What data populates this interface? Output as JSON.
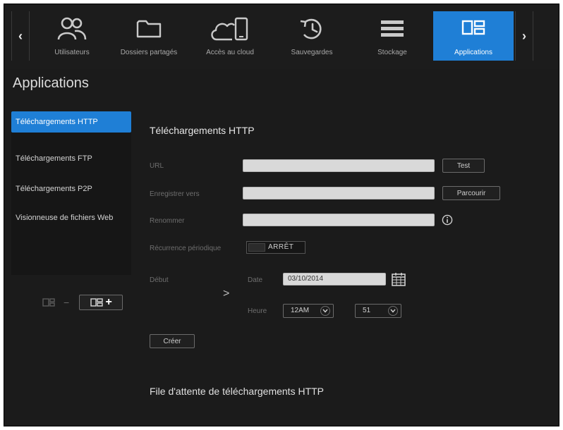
{
  "nav": {
    "prev_label": "‹",
    "next_label": "›",
    "items": [
      {
        "label": "Utilisateurs",
        "icon": "users-icon"
      },
      {
        "label": "Dossiers partagés",
        "icon": "folder-icon"
      },
      {
        "label": "Accès au cloud",
        "icon": "cloud-device-icon"
      },
      {
        "label": "Sauvegardes",
        "icon": "history-icon"
      },
      {
        "label": "Stockage",
        "icon": "storage-icon"
      },
      {
        "label": "Applications",
        "icon": "apps-icon"
      }
    ],
    "active": "Applications"
  },
  "page": {
    "title": "Applications"
  },
  "sidebar": {
    "items": [
      {
        "label": "Téléchargements HTTP"
      },
      {
        "label": "Téléchargements FTP"
      },
      {
        "label": "Téléchargements P2P"
      },
      {
        "label": "Visionneuse de fichiers Web"
      }
    ],
    "tools": {
      "remove_label": "−",
      "add_label": "+"
    }
  },
  "form": {
    "section_title": "Téléchargements HTTP",
    "url_label": "URL",
    "url_value": "",
    "test_label": "Test",
    "save_to_label": "Enregistrer vers",
    "save_to_value": "",
    "browse_label": "Parcourir",
    "rename_label": "Renommer",
    "rename_value": "",
    "recurring_label": "Récurrence périodique",
    "recurring_state": "ARRÊT",
    "start_label": "Début",
    "date_label": "Date",
    "date_value": "03/10/2014",
    "time_label": "Heure",
    "hour_value": "12AM",
    "minute_value": "51",
    "create_label": "Créer",
    "cursor_text": ">"
  },
  "queue": {
    "title": "File d'attente de téléchargements HTTP"
  },
  "colors": {
    "accent": "#1f7fd6",
    "background": "#1b1b1b",
    "input": "#d9d9d9"
  }
}
